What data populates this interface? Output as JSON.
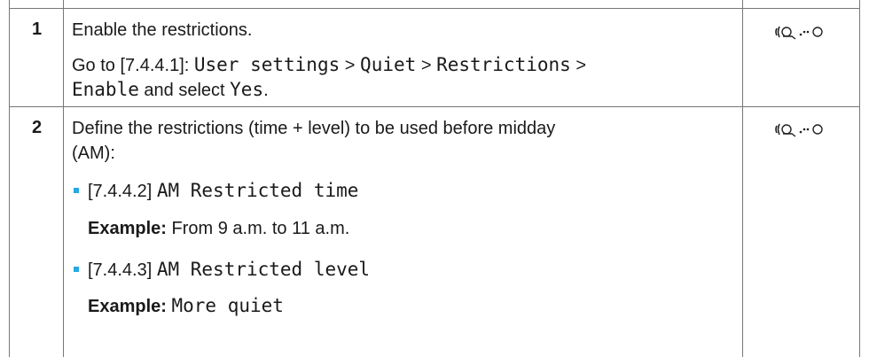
{
  "steps": [
    {
      "number": "1",
      "title": "Enable the restrictions.",
      "goto_prefix": "Go to [7.4.4.1]: ",
      "path": [
        "User settings",
        "Quiet",
        "Restrictions",
        "Enable"
      ],
      "separator": " > ",
      "select_text": " and select ",
      "select_value": "Yes",
      "period": ".",
      "icon": "user-interface-icon"
    },
    {
      "number": "2",
      "title_line1": "Define the restrictions (time + level) to be used before midday",
      "title_line2": "(AM):",
      "items": [
        {
          "code": "[7.4.4.2] ",
          "name": "AM Restricted time",
          "example_label": "Example:",
          "example_value": " From 9 a.m. to 11 a.m."
        },
        {
          "code": "[7.4.4.3] ",
          "name": "AM Restricted level",
          "example_label": "Example:",
          "example_value": "More quiet"
        }
      ],
      "icon": "user-interface-icon"
    }
  ],
  "colors": {
    "border": "#777777",
    "bullet": "#26a9e0",
    "text": "#1a1a1a"
  }
}
